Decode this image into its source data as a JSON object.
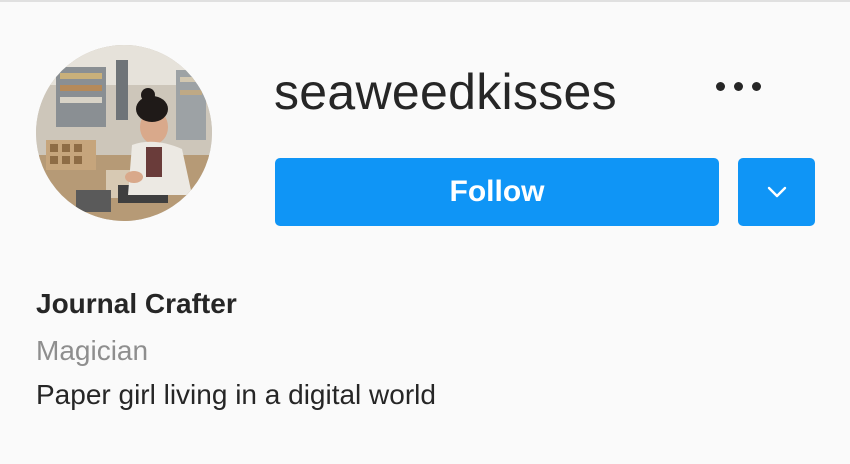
{
  "profile": {
    "username": "seaweedkisses",
    "full_name": "Journal Crafter",
    "category": "Magician",
    "bio": "Paper girl living in a digital world"
  },
  "actions": {
    "follow_label": "Follow",
    "more_icon": "more-horizontal-icon",
    "dropdown_icon": "chevron-down-icon"
  },
  "colors": {
    "primary": "#0f95f6",
    "background": "#fafafa",
    "text": "#262626",
    "secondary_text": "#8e8e8e"
  }
}
